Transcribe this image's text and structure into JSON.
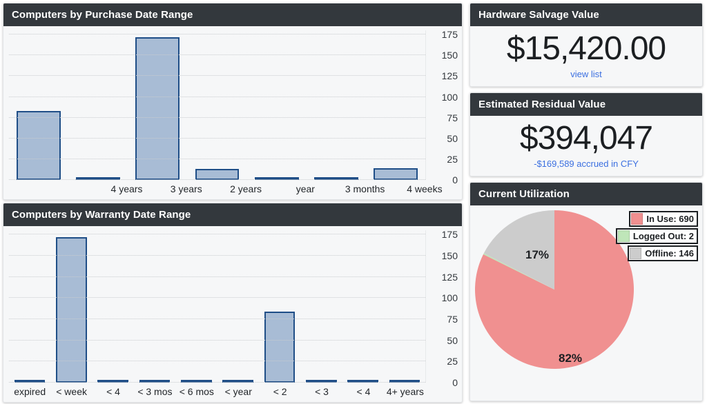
{
  "panels": {
    "purchase": {
      "title": "Computers by Purchase Date Range"
    },
    "warranty": {
      "title": "Computers by Warranty Date Range"
    },
    "salvage": {
      "title": "Hardware Salvage Value",
      "value": "$15,420.00",
      "link_label": "view list"
    },
    "residual": {
      "title": "Estimated Residual Value",
      "value": "$394,047",
      "sub_label": "-$169,589 accrued in CFY"
    },
    "utilization": {
      "title": "Current Utilization"
    }
  },
  "chart_data": [
    {
      "type": "bar",
      "title": "Computers by Purchase Date Range",
      "categories": [
        "",
        "4 years",
        "3 years",
        "2 years",
        "year",
        "3 months",
        "4 weeks"
      ],
      "values": [
        83,
        0,
        172,
        13,
        0,
        0,
        14
      ],
      "xlabel": "",
      "ylabel": "",
      "ylim": [
        0,
        180
      ],
      "yticks": [
        0,
        25,
        50,
        75,
        100,
        125,
        150,
        175
      ],
      "grid": true,
      "legend": "none",
      "bar_fill": "#a8bcd5",
      "bar_stroke": "#1f4e87"
    },
    {
      "type": "bar",
      "title": "Computers by Warranty Date Range",
      "categories": [
        "expired",
        "< week",
        "< 4",
        "< 3 mos",
        "< 6 mos",
        "< year",
        "< 2",
        "< 3",
        "< 4",
        "4+ years"
      ],
      "values": [
        0,
        172,
        0,
        0,
        0,
        0,
        84,
        0,
        0,
        0
      ],
      "xlabel": "",
      "ylabel": "",
      "ylim": [
        0,
        180
      ],
      "yticks": [
        0,
        25,
        50,
        75,
        100,
        125,
        150,
        175
      ],
      "grid": true,
      "legend": "none",
      "bar_fill": "#a8bcd5",
      "bar_stroke": "#1f4e87"
    },
    {
      "type": "pie",
      "title": "Current Utilization",
      "legend_position": "top-right",
      "slices": [
        {
          "name": "In Use",
          "value": 690,
          "percent": 82,
          "label": "82%",
          "color": "#f09090",
          "legend_label": "In Use: 690"
        },
        {
          "name": "Logged Out",
          "value": 2,
          "percent": 0,
          "label": "",
          "color": "#bfe6b9",
          "legend_label": "Logged Out: 2"
        },
        {
          "name": "Offline",
          "value": 146,
          "percent": 17,
          "label": "17%",
          "color": "#cccccc",
          "legend_label": "Offline: 146"
        }
      ]
    }
  ]
}
